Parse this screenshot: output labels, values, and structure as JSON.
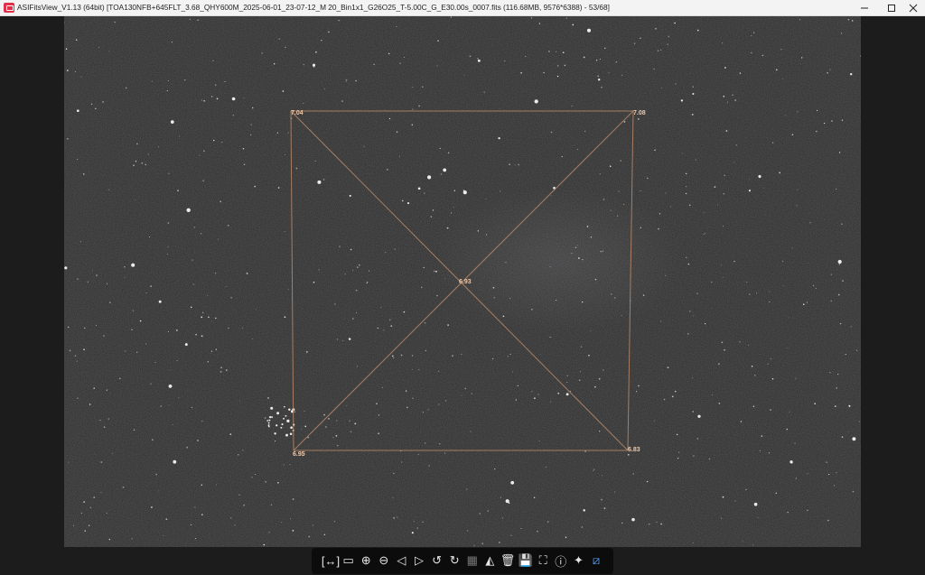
{
  "window": {
    "title": "ASIFitsView_V1.13 (64bit) [TOA130NFB+645FLT_3.68_QHY600M_2025-06-01_23-07-12_M 20_Bin1x1_G26O25_T-5.00C_G_E30.00s_0007.fits (116.68MB, 9576*6388) - 53/68]",
    "min_icon": "minimize-icon",
    "max_icon": "maximize-icon",
    "close_icon": "close-icon"
  },
  "overlay": {
    "top_left": "7.04",
    "top_right": "7.08",
    "bottom_left": "6.95",
    "bottom_right": "6.83",
    "center": "6.93",
    "line_color": "#b8896a",
    "label_color": "#f0c8a8"
  },
  "toolbar": {
    "tools": [
      {
        "name": "fit-window-icon",
        "glyph": "[↔]"
      },
      {
        "name": "actual-size-icon",
        "glyph": "▭"
      },
      {
        "name": "zoom-in-icon",
        "glyph": "⊕"
      },
      {
        "name": "zoom-out-icon",
        "glyph": "⊖"
      },
      {
        "name": "previous-icon",
        "glyph": "◁"
      },
      {
        "name": "next-icon",
        "glyph": "▷"
      },
      {
        "name": "rotate-left-icon",
        "glyph": "↺"
      },
      {
        "name": "rotate-right-icon",
        "glyph": "↻"
      },
      {
        "name": "stretch-icon",
        "glyph": "▦"
      },
      {
        "name": "histogram-icon",
        "glyph": "◭"
      },
      {
        "name": "delete-icon",
        "glyph": "🗑"
      },
      {
        "name": "save-icon",
        "glyph": "💾"
      },
      {
        "name": "fullscreen-icon",
        "glyph": "⛶"
      },
      {
        "name": "info-icon",
        "glyph": "ⓘ"
      },
      {
        "name": "star-detect-icon",
        "glyph": "✦"
      },
      {
        "name": "tilt-analysis-icon",
        "glyph": "⧄"
      }
    ]
  }
}
